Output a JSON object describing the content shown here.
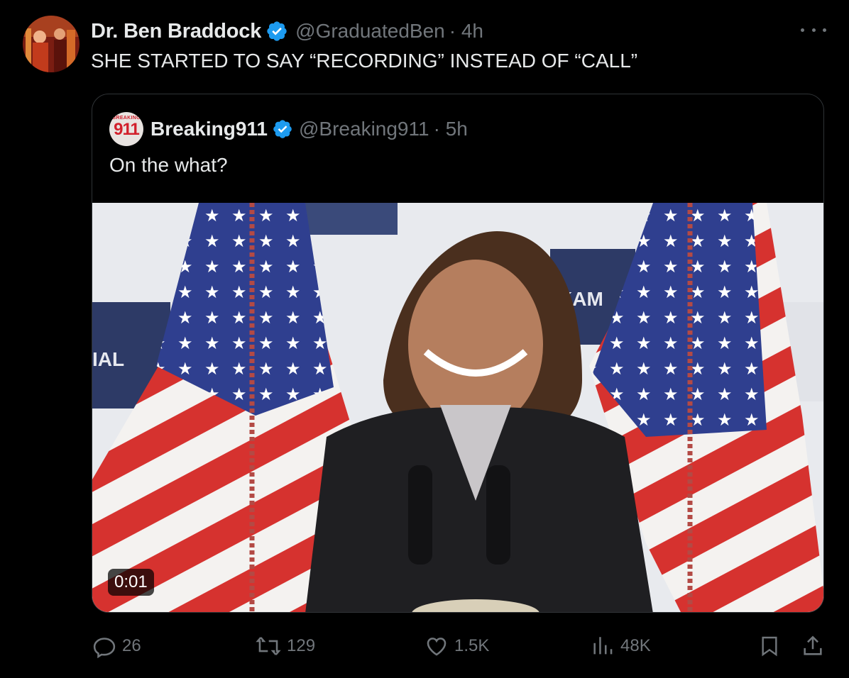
{
  "tweet": {
    "display_name": "Dr. Ben Braddock",
    "handle": "@GraduatedBen",
    "time": "· 4h",
    "text": "SHE STARTED TO SAY “RECORDING” INSTEAD OF “CALL”"
  },
  "quoted": {
    "display_name": "Breaking911",
    "handle": "@Breaking911",
    "time": "· 5h",
    "text": "On the what?",
    "avatar_small": "BREAKING",
    "avatar_big": "911",
    "video_duration": "0:01"
  },
  "actions": {
    "replies": "26",
    "reposts": "129",
    "likes": "1.5K",
    "views": "48K"
  },
  "colors": {
    "background": "#000000",
    "text": "#e7e9ea",
    "muted": "#71767b",
    "verified": "#1d9bf0",
    "border": "#2f3336"
  }
}
